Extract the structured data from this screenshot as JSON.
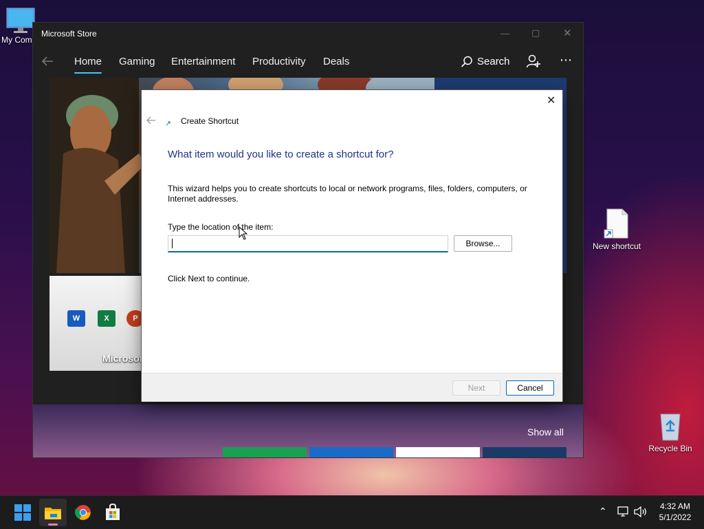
{
  "desktop": {
    "icons": [
      {
        "label": "My Com"
      },
      {
        "label": "New shortcut"
      },
      {
        "label": "Recycle Bin"
      }
    ]
  },
  "store": {
    "window_title": "Microsoft Store",
    "nav": {
      "tabs": [
        "Home",
        "Gaming",
        "Entertainment",
        "Productivity",
        "Deals"
      ],
      "active_tab": "Home",
      "search_label": "Search"
    },
    "office_card_label": "Microsoft",
    "show_all": "Show all"
  },
  "dialog": {
    "title": "Create Shortcut",
    "heading": "What item would you like to create a shortcut for?",
    "description": "This wizard helps you to create shortcuts to local or network programs, files, folders, computers, or Internet addresses.",
    "location_label": "Type the location of the item:",
    "location_value": "",
    "browse_label": "Browse...",
    "hint": "Click Next to continue.",
    "next_label": "Next",
    "cancel_label": "Cancel"
  },
  "taskbar": {
    "time": "4:32 AM",
    "date": "5/1/2022"
  },
  "colors": {
    "accent": "#4cc2ff",
    "dialog_heading": "#1e3287",
    "input_underline": "#0067c0"
  }
}
